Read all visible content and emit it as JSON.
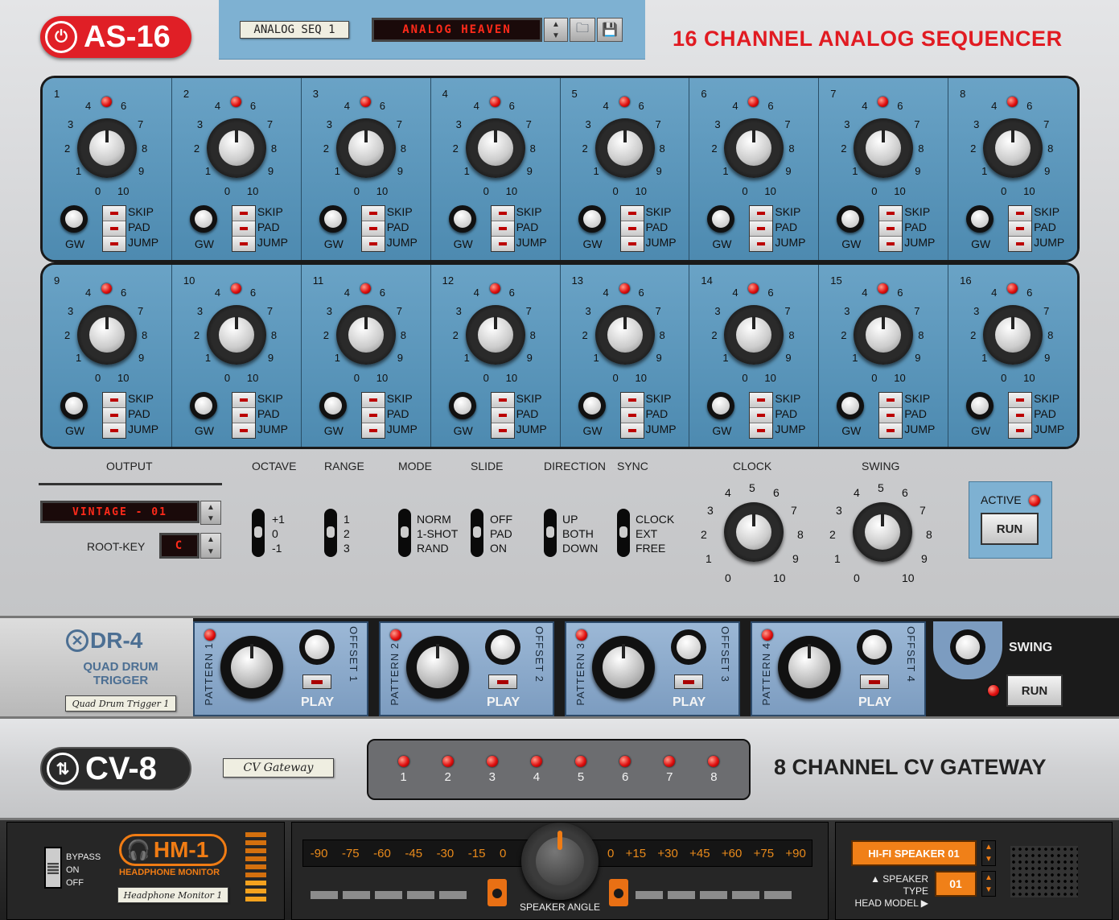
{
  "as16": {
    "logo": "AS-16",
    "patch_label": "ANALOG SEQ 1",
    "patch_name": "ANALOG HEAVEN",
    "title": "16 CHANNEL ANALOG SEQUENCER",
    "steps": [
      "1",
      "2",
      "3",
      "4",
      "5",
      "6",
      "7",
      "8",
      "9",
      "10",
      "11",
      "12",
      "13",
      "14",
      "15",
      "16"
    ],
    "step_scale": [
      "0",
      "1",
      "2",
      "3",
      "4",
      "6",
      "7",
      "8",
      "9",
      "10"
    ],
    "gw_label": "GW",
    "step_switches": [
      "SKIP",
      "PAD",
      "JUMP"
    ],
    "output_label": "OUTPUT",
    "output_value": "VINTAGE - 01",
    "root_key_label": "ROOT-KEY",
    "root_key_value": "C",
    "octave_label": "OCTAVE",
    "octave_options": [
      "+1",
      "0",
      "-1"
    ],
    "range_label": "RANGE",
    "range_options": [
      "1",
      "2",
      "3"
    ],
    "mode_label": "MODE",
    "mode_options": [
      "NORM",
      "1-SHOT",
      "RAND"
    ],
    "slide_label": "SLIDE",
    "slide_options": [
      "OFF",
      "PAD",
      "ON"
    ],
    "direction_label": "DIRECTION",
    "direction_options": [
      "UP",
      "BOTH",
      "DOWN"
    ],
    "sync_label": "SYNC",
    "sync_options": [
      "CLOCK",
      "EXT",
      "FREE"
    ],
    "clock_label": "CLOCK",
    "swing_label": "SWING",
    "knob_scale": [
      "0",
      "1",
      "2",
      "3",
      "4",
      "5",
      "6",
      "7",
      "8",
      "9",
      "10"
    ],
    "active_label": "ACTIVE",
    "run_label": "RUN"
  },
  "dr4": {
    "logo": "DR-4",
    "subtitle_1": "QUAD DRUM",
    "subtitle_2": "TRIGGER",
    "device_label": "Quad Drum Trigger 1",
    "lanes": [
      {
        "pattern": "PATTERN 1",
        "offset": "OFFSET 1",
        "play": "PLAY"
      },
      {
        "pattern": "PATTERN 2",
        "offset": "OFFSET 2",
        "play": "PLAY"
      },
      {
        "pattern": "PATTERN 3",
        "offset": "OFFSET 3",
        "play": "PLAY"
      },
      {
        "pattern": "PATTERN 4",
        "offset": "OFFSET 4",
        "play": "PLAY"
      }
    ],
    "swing_label": "SWING",
    "run_label": "RUN"
  },
  "cv8": {
    "logo": "CV-8",
    "device_label": "CV Gateway",
    "channels": [
      "1",
      "2",
      "3",
      "4",
      "5",
      "6",
      "7",
      "8"
    ],
    "title": "8 CHANNEL CV GATEWAY"
  },
  "hm1": {
    "bypass": "BYPASS",
    "on": "ON",
    "off": "OFF",
    "logo": "HM-1",
    "subtitle": "HEADPHONE MONITOR",
    "device_label": "Headphone Monitor 1",
    "angle_left": [
      "-90",
      "-75",
      "-60",
      "-45",
      "-30",
      "-15",
      "0"
    ],
    "angle_right": [
      "0",
      "+15",
      "+30",
      "+45",
      "+60",
      "+75",
      "+90"
    ],
    "speaker_angle": "SPEAKER ANGLE",
    "speaker_type_value": "HI-FI SPEAKER 01",
    "speaker_type_label": "▲ SPEAKER TYPE",
    "head_model_label": "HEAD MODEL ▶",
    "head_model_value": "01"
  },
  "colors": {
    "accent_red": "#e01f26",
    "panel_blue": "#5b96bb",
    "accent_orange": "#f07c14"
  }
}
